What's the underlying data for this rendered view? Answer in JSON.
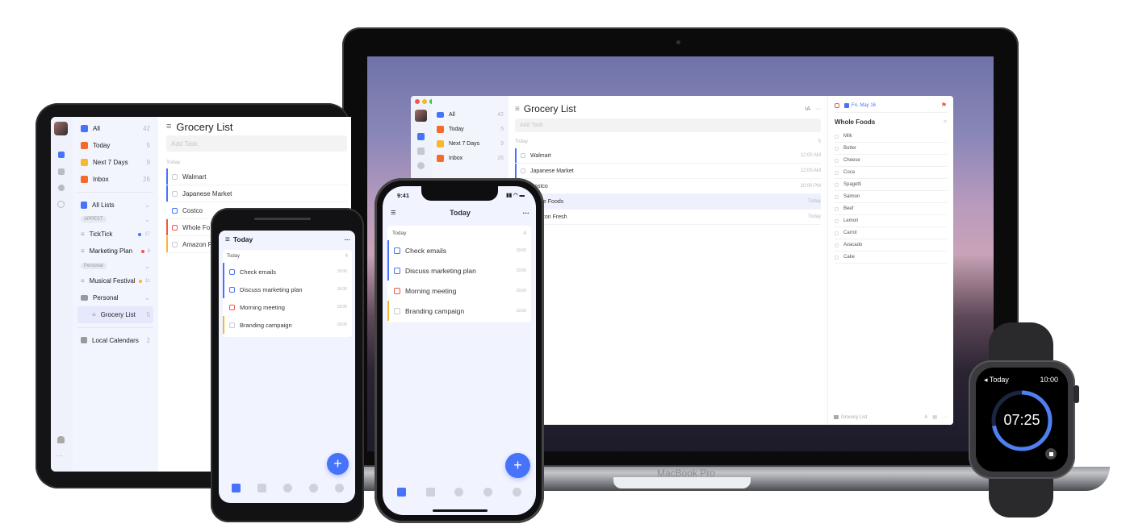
{
  "macbook": {
    "label": "MacBook Pro",
    "app": {
      "sidebar_items": [
        {
          "label": "All",
          "count": "42",
          "icon": "all-icon",
          "color": "#4772fa"
        },
        {
          "label": "Today",
          "count": "5",
          "icon": "calendar-today-icon",
          "color": "#f56b2a"
        },
        {
          "label": "Next 7 Days",
          "count": "9",
          "icon": "calendar-week-icon",
          "color": "#f7b731"
        },
        {
          "label": "Inbox",
          "count": "26",
          "icon": "inbox-icon",
          "color": "#f56b2a"
        }
      ],
      "title": "Grocery List",
      "add_task_placeholder": "Add Task",
      "section": "Today",
      "section_count": "5",
      "tasks": [
        {
          "name": "Walmart",
          "time": "12:00 AM"
        },
        {
          "name": "Japanese Market",
          "time": "12:00 AM"
        },
        {
          "name": "Costco",
          "time": "10:00 PM"
        },
        {
          "name": "Whole Foods",
          "time": "Today"
        },
        {
          "name": "Amazon Fresh",
          "time": "Today"
        }
      ],
      "detail": {
        "date": "Fri, May 16",
        "title": "Whole Foods",
        "items": [
          "Milk",
          "Butter",
          "Cheese",
          "Coca",
          "Spagetti",
          "Salmon",
          "Beef",
          "Lemon",
          "Carrot",
          "Avacado",
          "Cake"
        ],
        "footer_list": "Grocery List"
      }
    }
  },
  "ipad": {
    "sidebar_items": [
      {
        "label": "All",
        "count": "42"
      },
      {
        "label": "Today",
        "count": "5"
      },
      {
        "label": "Next 7 Days",
        "count": "9"
      },
      {
        "label": "Inbox",
        "count": "26"
      }
    ],
    "all_lists": "All Lists",
    "group_appest": "APPEST",
    "appest_items": [
      {
        "label": "TickTick",
        "count": "17",
        "dot": "#4772fa"
      },
      {
        "label": "Marketing Plan",
        "count": "8",
        "dot": "#f0554a"
      }
    ],
    "group_personal": "Personal",
    "personal_items": [
      {
        "label": "Musical Festival",
        "count": "11",
        "dot": "#f7b731"
      }
    ],
    "folder": "Personal",
    "folder_child": {
      "label": "Grocery List",
      "count": "5"
    },
    "local_calendars": {
      "label": "Local Calendars",
      "count": "2"
    },
    "main": {
      "title": "Grocery List",
      "add_task_placeholder": "Add Task",
      "section": "Today",
      "tasks": [
        "Walmart",
        "Japanese Market",
        "Costco",
        "Whole Fo",
        "Amazon Fre"
      ]
    }
  },
  "android": {
    "title": "Today",
    "section": "Today",
    "section_count": "4",
    "tasks": [
      {
        "name": "Check emails",
        "time": "18:00"
      },
      {
        "name": "Discuss marketing plan",
        "time": "18:00"
      },
      {
        "name": "Morning meeting",
        "time": "18:00"
      },
      {
        "name": "Branding campaign",
        "time": "18:00"
      }
    ],
    "fab": "+"
  },
  "iphone": {
    "status_time": "9:41",
    "title": "Today",
    "section": "Today",
    "section_count": "4",
    "tasks": [
      {
        "name": "Check emails",
        "time": "18:00"
      },
      {
        "name": "Discuss marketing plan",
        "time": "18:00"
      },
      {
        "name": "Morning meeting",
        "time": "18:00"
      },
      {
        "name": "Branding campaign",
        "time": "18:00"
      }
    ],
    "fab": "+"
  },
  "watch": {
    "back_label": "◂ Today",
    "clock": "10:00",
    "timer": "07:25",
    "progress_fraction": 0.72,
    "ring_color": "#4f7ff0"
  },
  "colors": {
    "accent": "#4772fa",
    "priority_high": "#f0554a",
    "priority_medium": "#f7b731",
    "priority_low": "#4772fa"
  }
}
